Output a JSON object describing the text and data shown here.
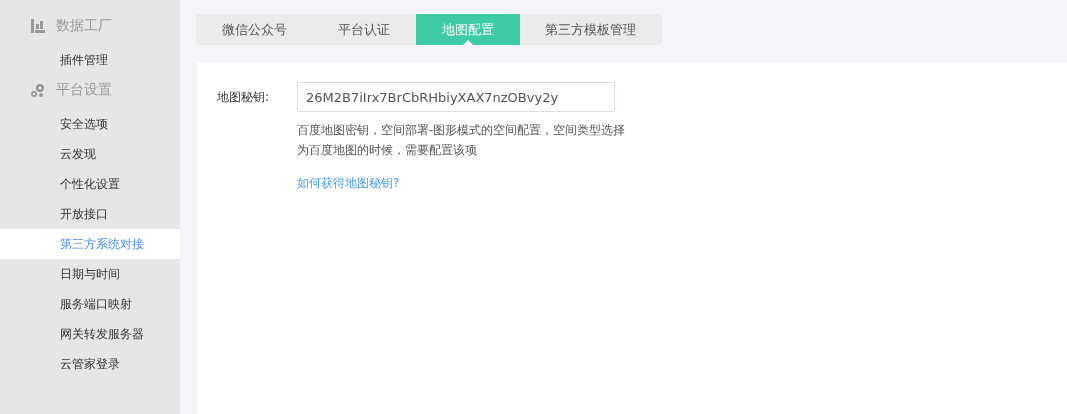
{
  "sidebar": {
    "groups": [
      {
        "kind": "data",
        "title": "数据工厂",
        "items": [
          {
            "label": "插件管理",
            "selected": false
          }
        ]
      },
      {
        "kind": "settings",
        "title": "平台设置",
        "items": [
          {
            "label": "安全选项",
            "selected": false
          },
          {
            "label": "云发现",
            "selected": false
          },
          {
            "label": "个性化设置",
            "selected": false
          },
          {
            "label": "开放接口",
            "selected": false
          },
          {
            "label": "第三方系统对接",
            "selected": true
          },
          {
            "label": "日期与时间",
            "selected": false
          },
          {
            "label": "服务端口映射",
            "selected": false
          },
          {
            "label": "网关转发服务器",
            "selected": false
          },
          {
            "label": "云管家登录",
            "selected": false
          }
        ]
      }
    ]
  },
  "tabs": [
    {
      "label": "微信公众号",
      "selected": false
    },
    {
      "label": "平台认证",
      "selected": false
    },
    {
      "label": "地图配置",
      "selected": true
    },
    {
      "label": "第三方模板管理",
      "selected": false
    }
  ],
  "form": {
    "label": "地图秘钥:",
    "value": "26M2B7iIrx7BrCbRHbiyXAX7nzOBvy2y",
    "help": "百度地图密钥，空间部署-图形模式的空间配置，空间类型选择为百度地图的时候，需要配置该项",
    "link": "如何获得地图秘钥?"
  }
}
